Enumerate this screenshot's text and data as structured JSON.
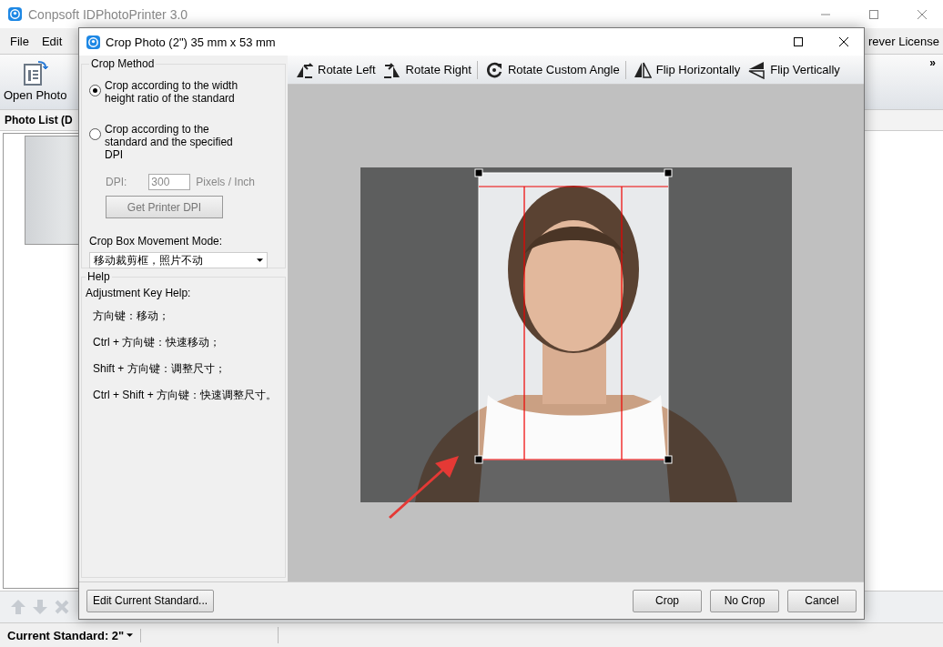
{
  "main_window": {
    "title": "Conpsoft IDPhotoPrinter 3.0",
    "menu": [
      "File",
      "Edit"
    ],
    "menu_right": "rever License",
    "toolbar": {
      "open_photo": "Open Photo",
      "overflow": "»"
    },
    "photo_list": {
      "title": "Photo List (D"
    },
    "status_bar": {
      "standard": "Current Standard: 2\""
    }
  },
  "dialog": {
    "title": "Crop Photo (2\") 35 mm x 53 mm",
    "crop_method": {
      "title": "Crop Method",
      "options": [
        {
          "label": "Crop according to the width height ratio of the standard",
          "selected": true
        },
        {
          "label": "Crop according to the standard and the specified DPI",
          "selected": false
        }
      ],
      "dpi": {
        "label": "DPI:",
        "value": "300",
        "unit": "Pixels / Inch",
        "disabled": true
      },
      "printer_dpi_button": "Get Printer DPI",
      "movement_label": "Crop Box Movement Mode:",
      "movement_select": "移动裁剪框，照片不动"
    },
    "help": {
      "title": "Help",
      "heading": "Adjustment Key Help:",
      "lines": [
        "方向键：移动；",
        "Ctrl + 方向键：快速移动；",
        "Shift + 方向键：调整尺寸；",
        "Ctrl + Shift + 方向键：快速调整尺寸。"
      ]
    },
    "toolbar": [
      {
        "kind": "rotate-left",
        "label": "Rotate Left",
        "separator_after": false
      },
      {
        "kind": "rotate-right",
        "label": "Rotate Right",
        "separator_after": true
      },
      {
        "kind": "rotate-custom",
        "label": "Rotate Custom Angle",
        "separator_after": true
      },
      {
        "kind": "flip-h",
        "label": "Flip Horizontally",
        "separator_after": false
      },
      {
        "kind": "flip-v",
        "label": "Flip Vertically",
        "separator_after": false
      }
    ],
    "footer": {
      "edit_standard": "Edit Current Standard...",
      "buttons": [
        "Crop",
        "No Crop",
        "Cancel"
      ]
    }
  }
}
